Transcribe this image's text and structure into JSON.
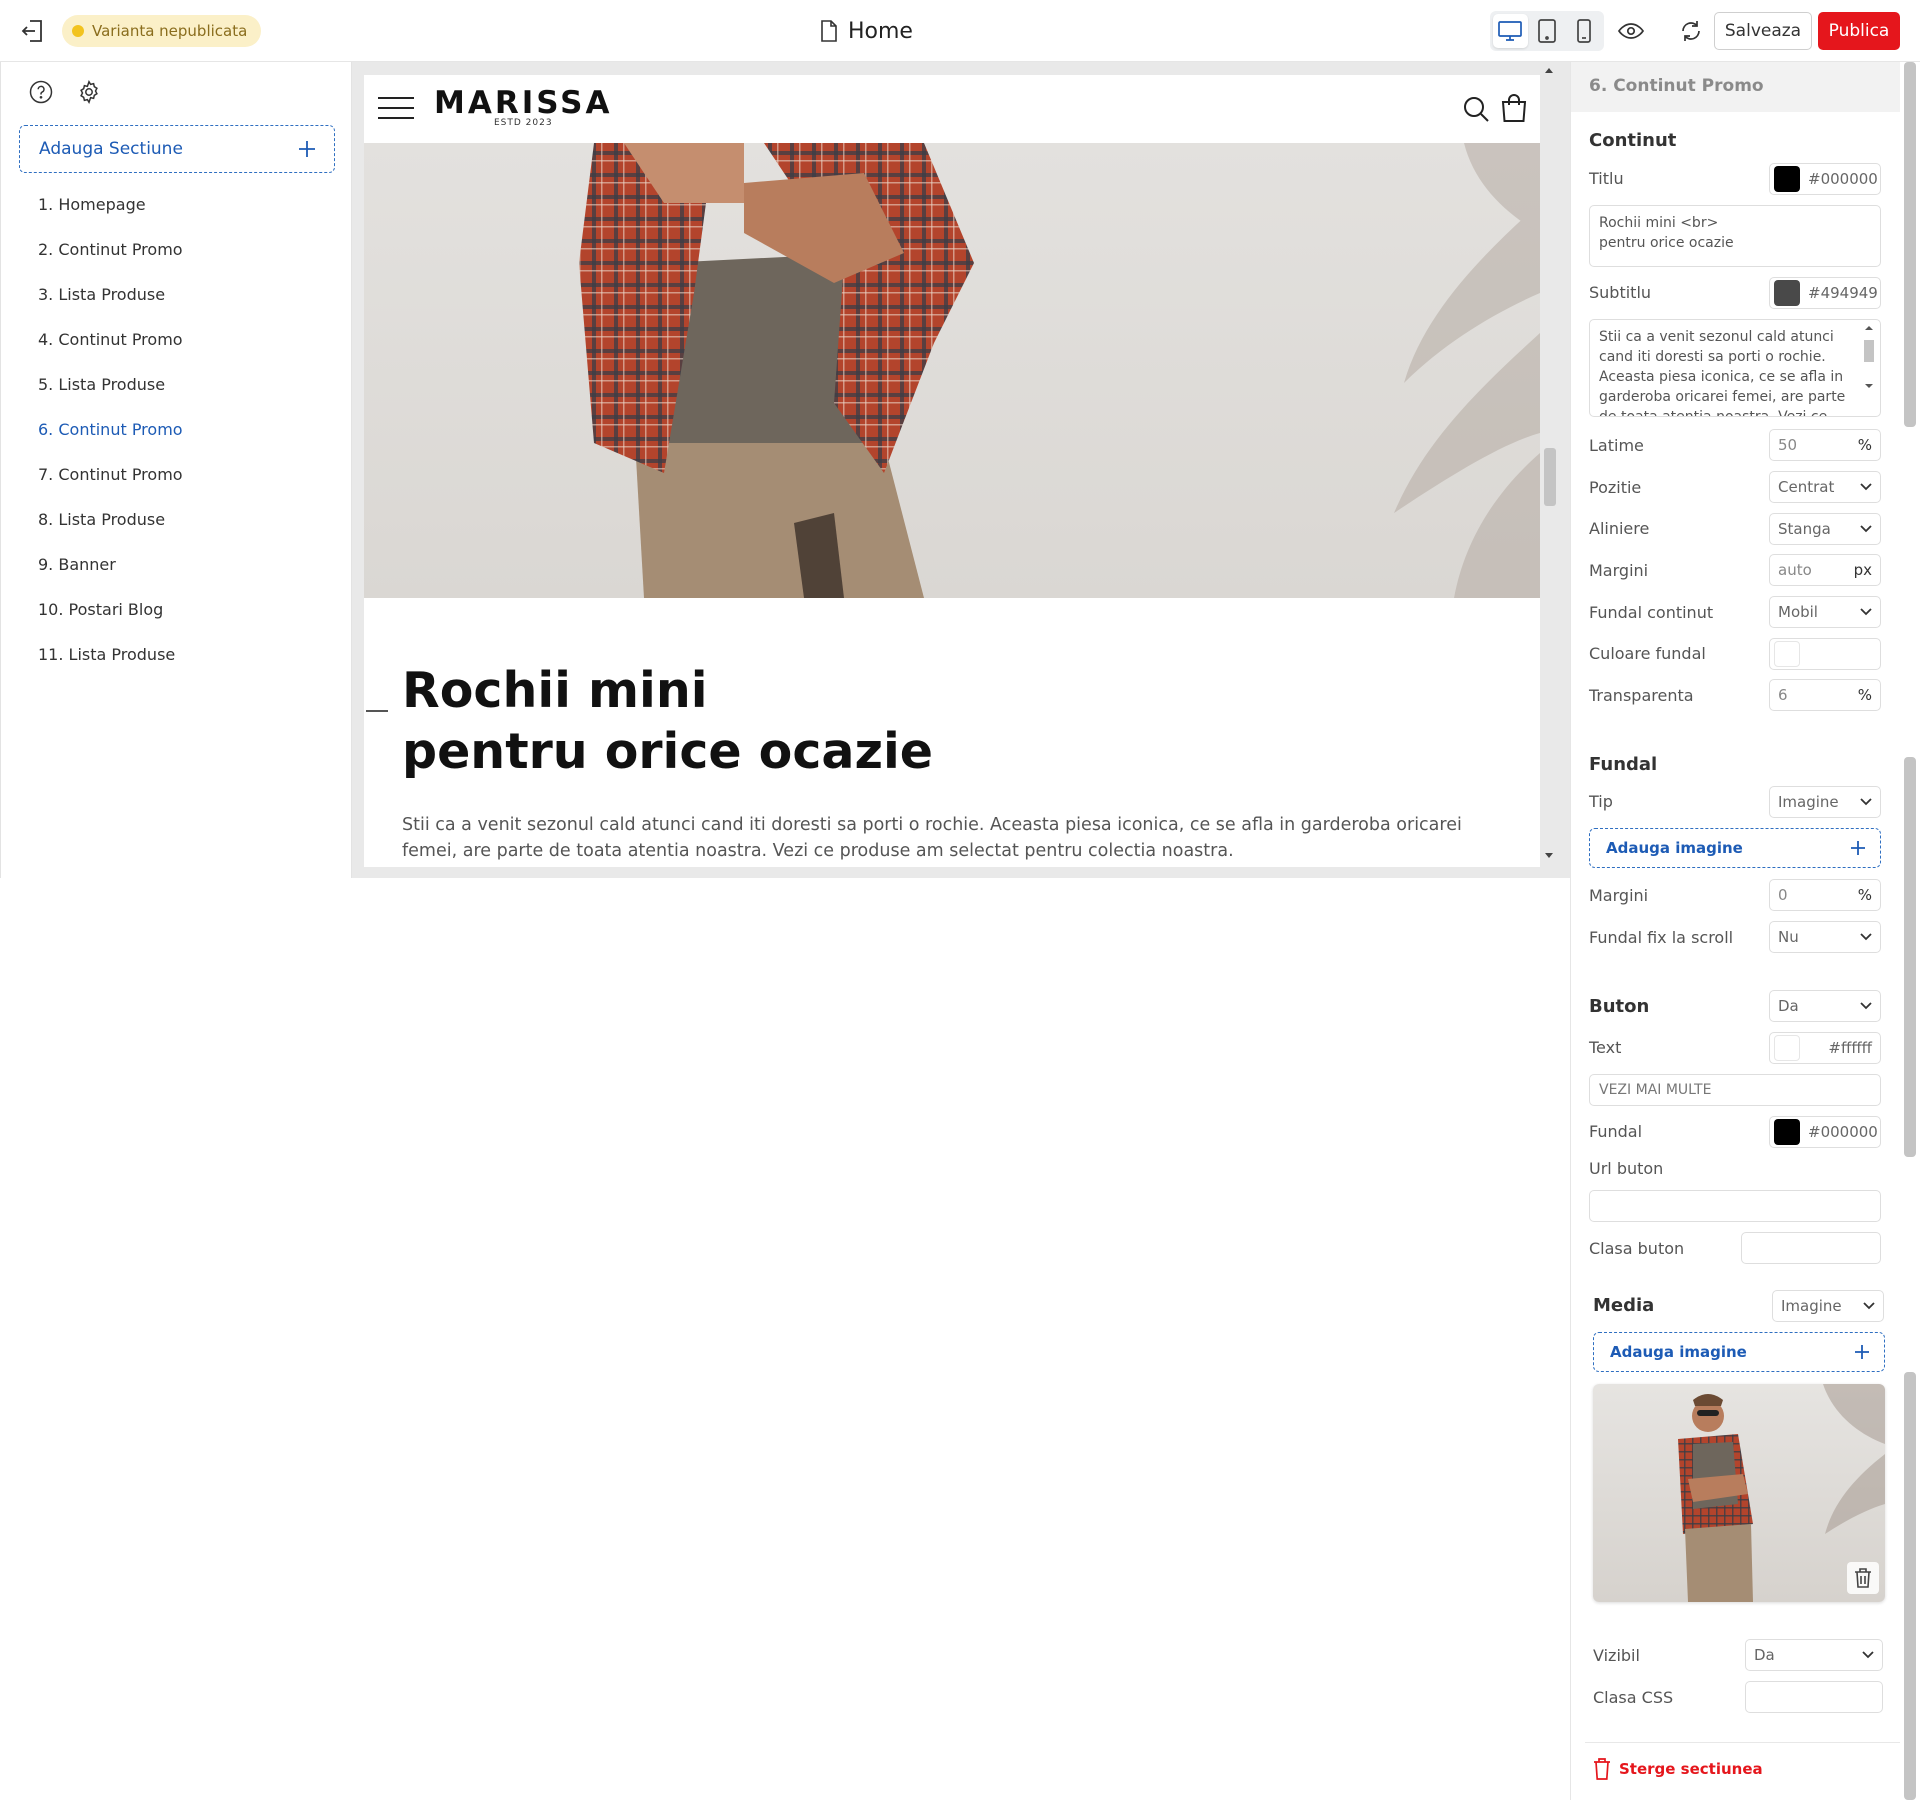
{
  "topbar": {
    "status_badge": "Varianta nepublicata",
    "page_title": "Home",
    "save_label": "Salveaza",
    "publish_label": "Publica",
    "status_color": "#f2c31f",
    "publish_color": "#e5161c"
  },
  "sidebar": {
    "add_section_label": "Adauga Sectiune",
    "items": [
      {
        "label": "1. Homepage"
      },
      {
        "label": "2. Continut Promo"
      },
      {
        "label": "3. Lista Produse"
      },
      {
        "label": "4. Continut Promo"
      },
      {
        "label": "5. Lista Produse"
      },
      {
        "label": "6. Continut Promo"
      },
      {
        "label": "7. Continut Promo"
      },
      {
        "label": "8. Lista Produse"
      },
      {
        "label": "9. Banner"
      },
      {
        "label": "10. Postari Blog"
      },
      {
        "label": "11. Lista Produse"
      }
    ],
    "active_index": 5,
    "accent_color": "#1d5bb5"
  },
  "preview": {
    "logo_name": "MARISSA",
    "logo_sub": "ESTD 2023",
    "title": "Rochii mini\npentru orice ocazie",
    "subtitle": "Stii ca a venit sezonul cald atunci cand iti doresti sa porti o rochie. Aceasta piesa iconica, ce se afla in garderoba oricarei femei, are parte de toata atentia noastra. Vezi ce produse am selectat pentru colectia noastra."
  },
  "panel": {
    "header": "6. Continut Promo",
    "content": {
      "heading": "Continut",
      "title_label": "Titlu",
      "title_color": "#000000",
      "title_text": "Rochii mini <br>\npentru orice ocazie",
      "subtitle_label": "Subtitlu",
      "subtitle_color": "#494949",
      "subtitle_text": "Stii ca a venit sezonul cald atunci cand iti doresti sa porti o rochie. Aceasta piesa iconica, ce se afla in garderoba oricarei femei, are parte de toata atentia noastra. Vezi ce",
      "width_label": "Latime",
      "width_value": "50",
      "width_unit": "%",
      "position_label": "Pozitie",
      "position_value": "Centrat",
      "align_label": "Aliniere",
      "align_value": "Stanga",
      "margins_label": "Margini",
      "margins_value": "auto",
      "margins_unit": "px",
      "content_bg_label": "Fundal continut",
      "content_bg_value": "Mobil",
      "bg_color_label": "Culoare fundal",
      "transparency_label": "Transparenta",
      "transparency_value": "6",
      "transparency_unit": "%"
    },
    "background": {
      "heading": "Fundal",
      "type_label": "Tip",
      "type_value": "Imagine",
      "add_image_label": "Adauga imagine",
      "margins_label": "Margini",
      "margins_value": "0",
      "margins_unit": "%",
      "fixed_label": "Fundal fix la scroll",
      "fixed_value": "Nu"
    },
    "button": {
      "heading": "Buton",
      "enabled_value": "Da",
      "text_label": "Text",
      "text_color": "#ffffff",
      "text_value": "VEZI MAI MULTE",
      "bg_label": "Fundal",
      "bg_color": "#000000",
      "url_label": "Url buton",
      "class_label": "Clasa buton"
    },
    "media": {
      "heading": "Media",
      "type_value": "Imagine",
      "add_image_label": "Adauga imagine"
    },
    "visible_label": "Vizibil",
    "visible_value": "Da",
    "css_class_label": "Clasa CSS",
    "delete_label": "Sterge sectiunea"
  }
}
